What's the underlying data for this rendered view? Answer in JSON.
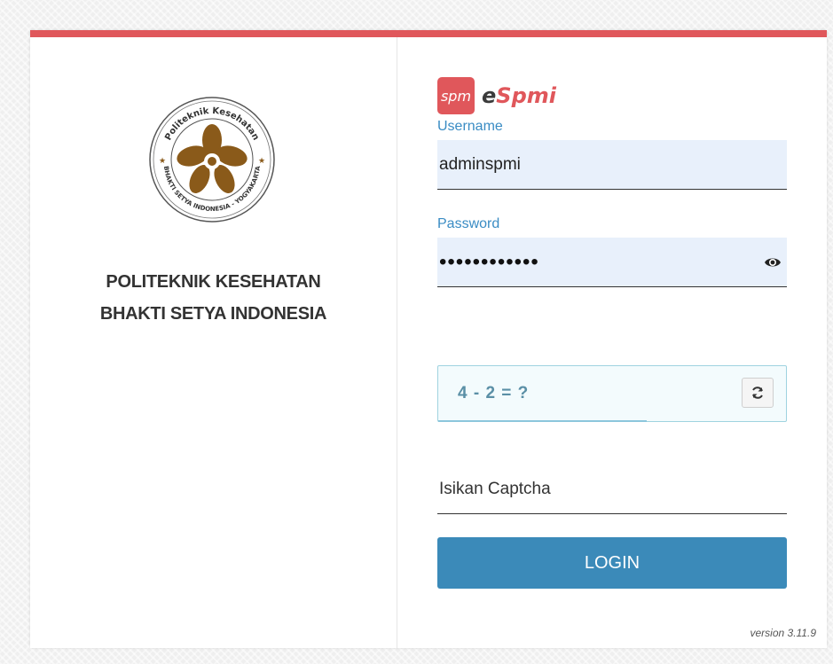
{
  "colors": {
    "brand_red": "#e0575b",
    "label_blue": "#3a8cc4",
    "login_button": "#3b8ab9",
    "input_fill": "#e8f0fb",
    "captcha_text": "#5a8fa6",
    "logo_brown": "#8a5a1a"
  },
  "institution": {
    "logo_text_top": "Politeknik Kesehatan",
    "logo_text_bottom": "BHAKTI SETYA INDONESIA - YOGYAKARTA",
    "name_line1": "POLITEKNIK KESEHATAN",
    "name_line2": "BHAKTI SETYA INDONESIA"
  },
  "brand": {
    "badge": "spm",
    "name_prefix": "e",
    "name_suffix": "Spmi"
  },
  "form": {
    "username_label": "Username",
    "username_value": "adminspmi",
    "password_label": "Password",
    "password_masked": "••••••••••••",
    "show_password_icon": "eye-icon",
    "captcha_question": "4 - 2 = ?",
    "refresh_icon": "refresh-icon",
    "captcha_placeholder": "Isikan Captcha",
    "login_label": "LOGIN"
  },
  "footer": {
    "version": "version 3.11.9"
  }
}
